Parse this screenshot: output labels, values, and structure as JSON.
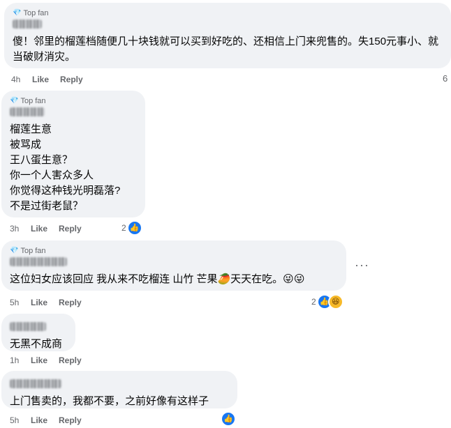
{
  "comments": [
    {
      "badge": "Top fan",
      "author": "潘君梅",
      "text": "傻！邻里的榴莲档随便几十块钱就可以买到好吃的、还相信上门来兜售的。失150元事小、就当破财消灾。",
      "time": "4h",
      "like_label": "Like",
      "reply_label": "Reply",
      "reaction_count": ""
    },
    {
      "badge": "Top fan",
      "author": "HL Seh",
      "text": "榴莲生意\n被骂成\n王八蛋生意？\n你一个人害众多人\n你觉得这种钱光明磊落?\n不是过街老鼠？",
      "time": "3h",
      "like_label": "Like",
      "reply_label": "Reply",
      "reaction_count": "2"
    },
    {
      "badge": "Top fan",
      "author": "Yee Hock Fatt",
      "text": "这位妇女应该回应 我从来不吃榴连 山竹 芒果🥭天天在吃。😜😜",
      "time": "5h",
      "like_label": "Like",
      "reply_label": "Reply",
      "reaction_count": "2"
    },
    {
      "badge": "",
      "author": "Wan Vic",
      "text": "无黑不成商",
      "time": "1h",
      "like_label": "Like",
      "reply_label": "Reply",
      "reaction_count": ""
    },
    {
      "badge": "",
      "author": "Nicole Ping",
      "text": "上门售卖的，我都不要，之前好像有这样子",
      "time": "5h",
      "like_label": "Like",
      "reply_label": "Reply",
      "reaction_count": ""
    }
  ],
  "more_label": "···",
  "edge_number": "6",
  "icons": {
    "badge": "gem-icon",
    "like": "thumbs-up-icon",
    "haha": "laughing-face-icon",
    "more": "more-options-icon"
  },
  "colors": {
    "bubble": "#f0f2f5",
    "secondary_text": "#65676b",
    "like_blue": "#1877f2"
  }
}
